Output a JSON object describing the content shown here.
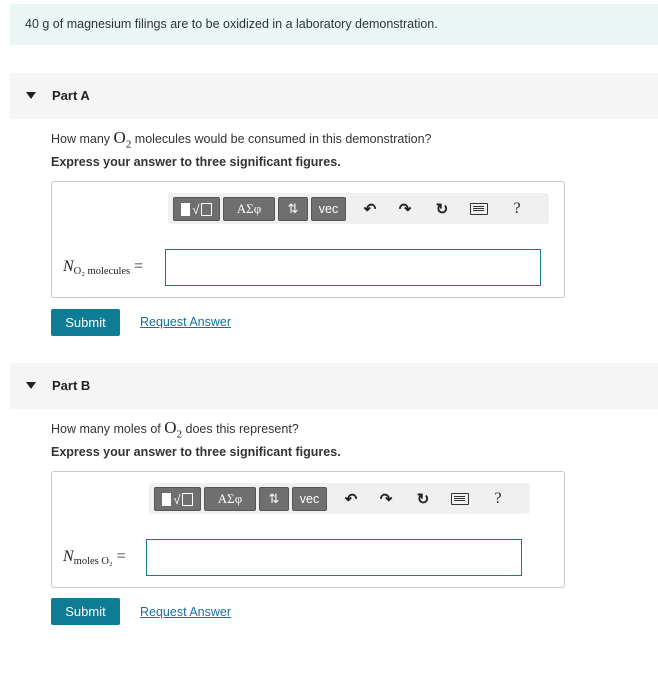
{
  "intro": {
    "text": "40 g of magnesium filings are to be oxidized in a laboratory demonstration."
  },
  "toolbar": {
    "greek_label": "ΑΣφ",
    "arrows_label": "⇅",
    "vec_label": "vec",
    "undo_glyph": "↶",
    "redo_glyph": "↷",
    "reset_glyph": "↻",
    "help_glyph": "?"
  },
  "parts": [
    {
      "title": "Part A",
      "question_before": "How many ",
      "question_molecule": "O",
      "question_molecule_sub": "2",
      "question_after": " molecules would be consumed in this demonstration?",
      "instruction": "Express your answer to three significant figures.",
      "variable": {
        "symbol": "N",
        "subscript": "O₂ molecules",
        "equals": "="
      },
      "answer_value": "",
      "submit_label": "Submit",
      "request_answer_label": "Request Answer"
    },
    {
      "title": "Part B",
      "question_before": "How many moles of ",
      "question_molecule": "O",
      "question_molecule_sub": "2",
      "question_after": " does this represent?",
      "instruction": "Express your answer to three significant figures.",
      "variable": {
        "symbol": "N",
        "subscript": "moles O₂",
        "equals": "="
      },
      "answer_value": "",
      "submit_label": "Submit",
      "request_answer_label": "Request Answer"
    }
  ]
}
